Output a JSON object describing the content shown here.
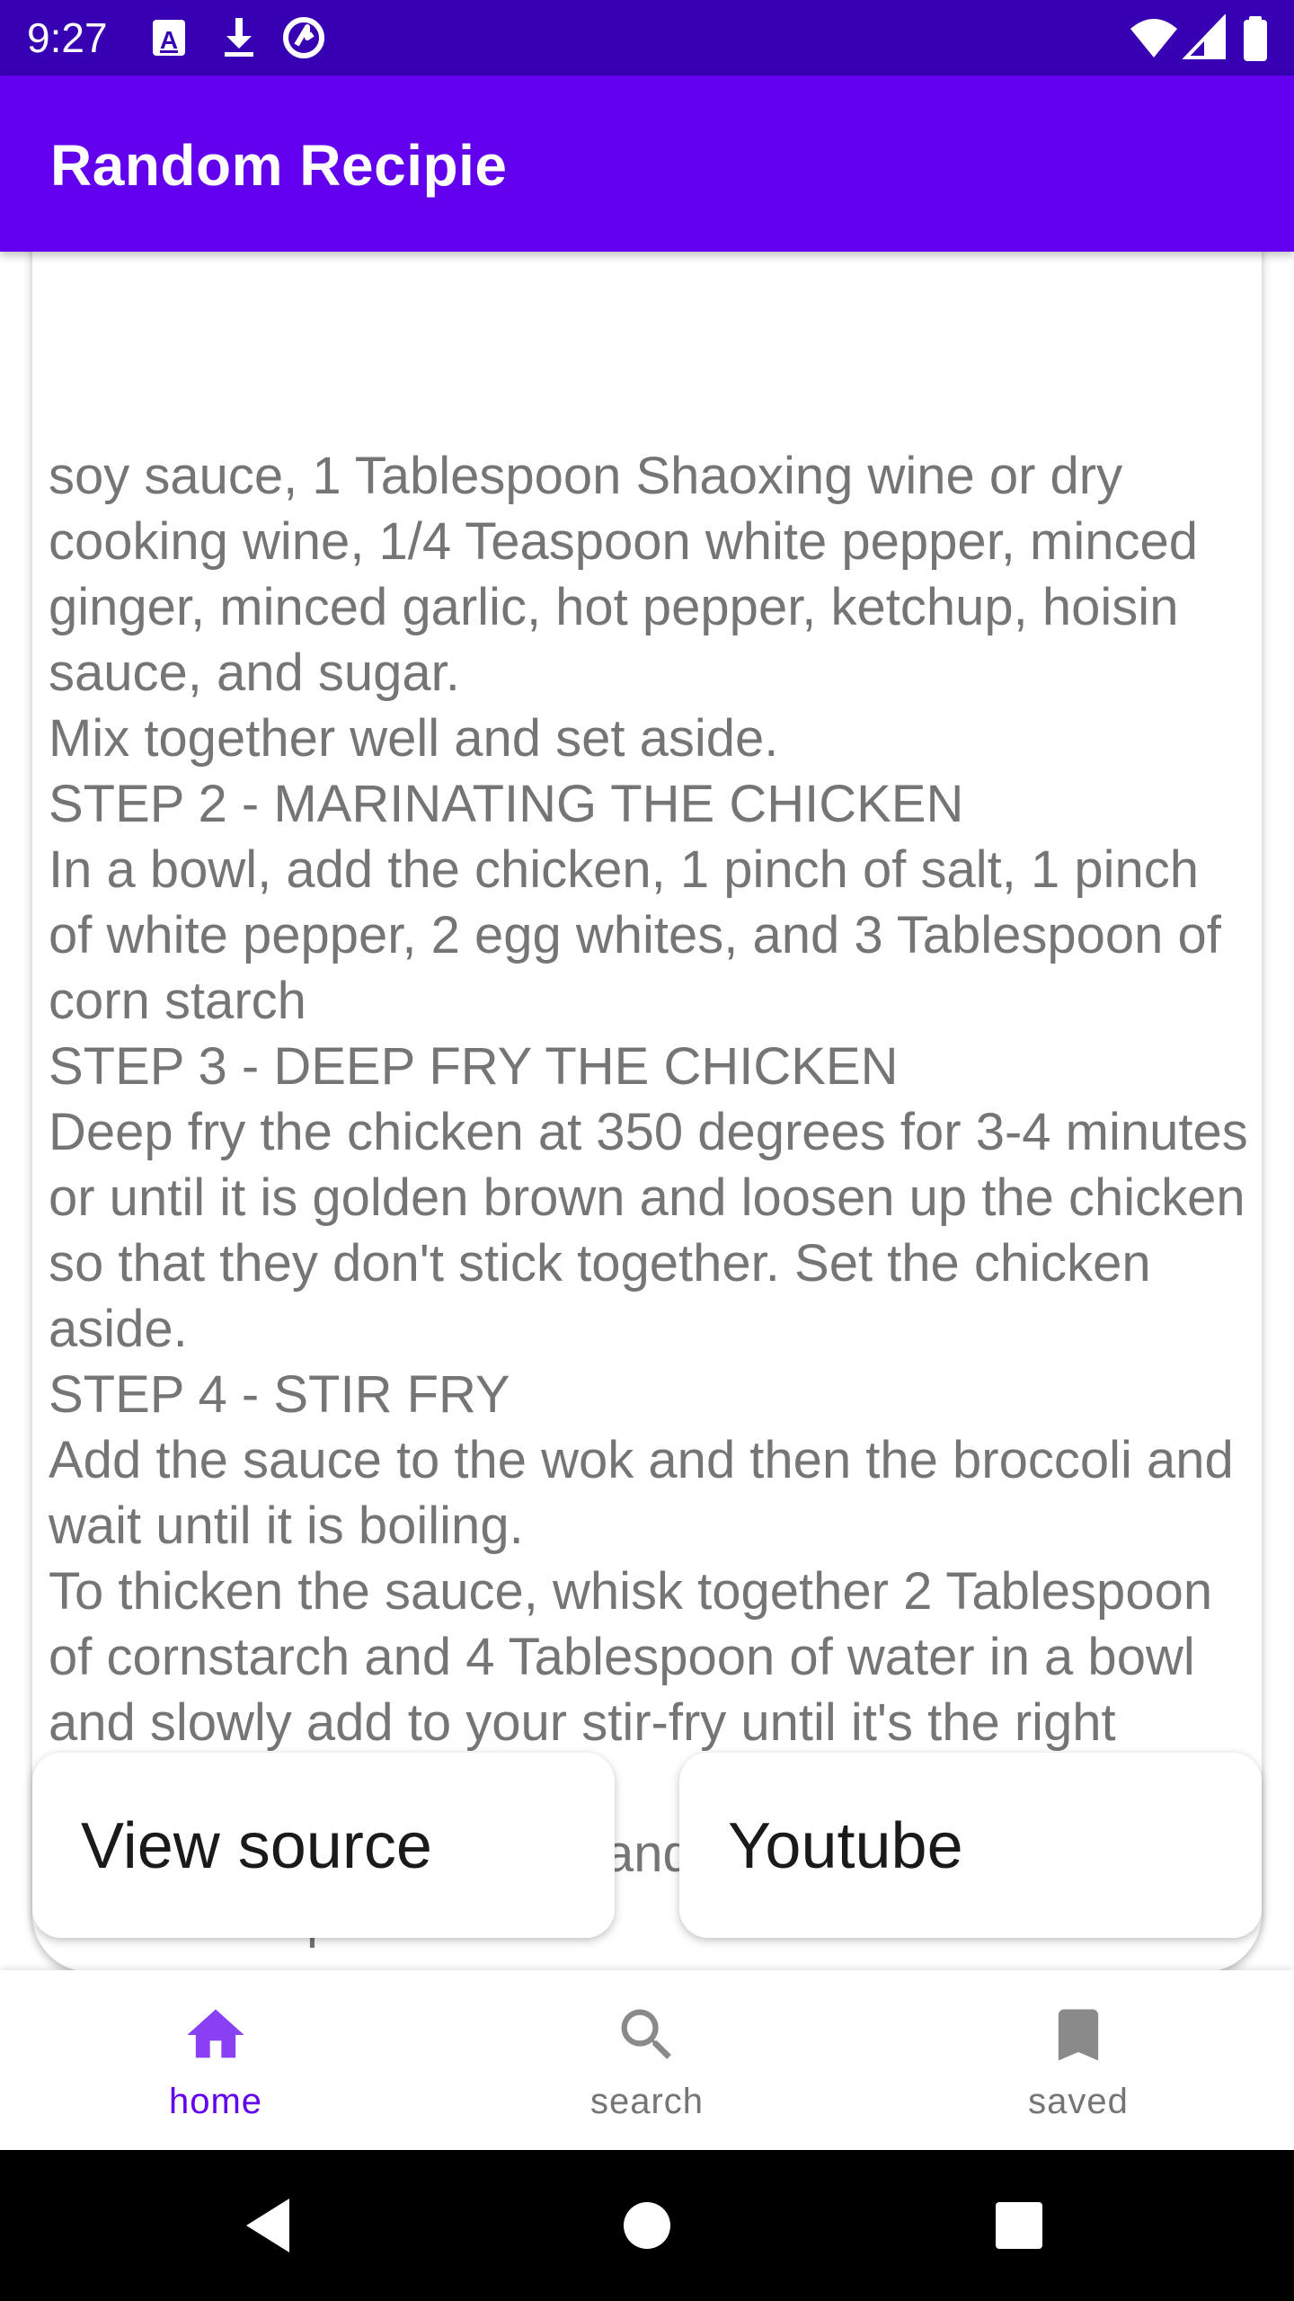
{
  "status_bar": {
    "time": "9:27",
    "left_icons": [
      "font-notification-icon",
      "download-icon",
      "sync-icon"
    ],
    "right_icons": [
      "wifi-icon",
      "cell-signal-icon",
      "battery-icon"
    ]
  },
  "app_bar": {
    "title": "Random Recipie"
  },
  "recipe": {
    "instructions": "soy sauce, 1 Tablespoon Shaoxing wine or dry cooking wine, 1/4 Teaspoon white pepper, minced ginger, minced garlic, hot pepper, ketchup, hoisin sauce, and sugar.\nMix together well and set aside.\nSTEP 2 - MARINATING THE CHICKEN\nIn a bowl, add the chicken, 1 pinch of salt, 1 pinch of white pepper, 2 egg whites, and 3 Tablespoon of corn starch\nSTEP 3 - DEEP FRY THE CHICKEN\nDeep fry the chicken at 350 degrees for 3-4 minutes or until it is golden brown and loosen up the chicken so that they don't stick together. Set the chicken aside.\nSTEP 4 - STIR FRY\nAdd the sauce to the wok and then the broccoli and wait until it is boiling.\nTo thicken the sauce, whisk together 2 Tablespoon of cornstarch and 4 Tablespoon of water in a bowl and slowly add to your stir-fry until it's the right thickness.\nNext add in the chicken and stir-fry for a minute and serve on a plate"
  },
  "actions": {
    "view_source_label": "View source",
    "youtube_label": "Youtube"
  },
  "bottom_nav": {
    "items": [
      {
        "label": "home",
        "icon": "home-icon",
        "selected": true
      },
      {
        "label": "search",
        "icon": "search-icon",
        "selected": false
      },
      {
        "label": "saved",
        "icon": "bookmark-icon",
        "selected": false
      }
    ],
    "active_color": "#6200ee",
    "inactive_color": "#757575"
  },
  "colors": {
    "status_bar": "#3700b3",
    "primary": "#6200ee",
    "body_text": "#757575"
  }
}
